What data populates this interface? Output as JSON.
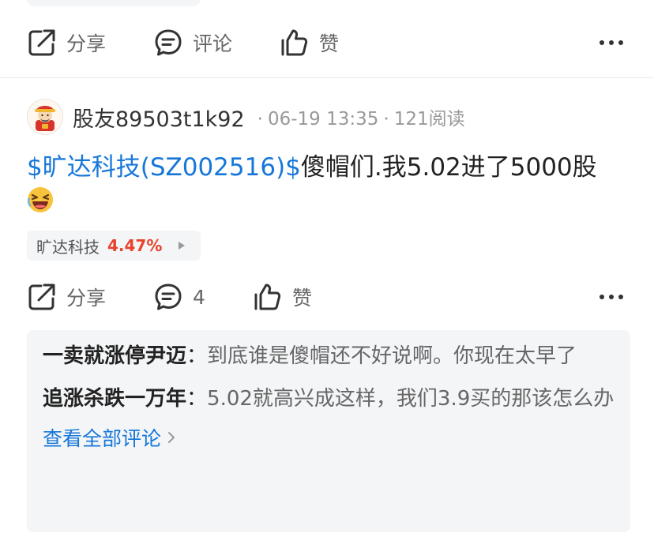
{
  "previous_post": {
    "actions": {
      "share_label": "分享",
      "comment_label": "评论",
      "like_label": "赞"
    }
  },
  "post": {
    "username": "股友89503t1k92",
    "date": "06-19 13:35",
    "reads": "121阅读",
    "meta_separator": "·",
    "stock_tag": "$旷达科技(SZ002516)$",
    "text": "傻帽们.我5.02进了5000股",
    "emoji": "laughing-face",
    "stock_chip": {
      "name": "旷达科技",
      "change": "4.47%",
      "change_color": "#e8432e"
    },
    "actions": {
      "share_label": "分享",
      "comment_count": "4",
      "like_label": "赞"
    }
  },
  "comments": [
    {
      "author": "一卖就涨停尹迈",
      "separator": "：",
      "text": "到底谁是傻帽还不好说啊。你现在太早了"
    },
    {
      "author": "追涨杀跌一万年",
      "separator": "：",
      "text": "5.02就高兴成这样，我们3.9买的那该怎么办"
    }
  ],
  "view_all_comments": "查看全部评论",
  "colors": {
    "link_blue": "#1677d9",
    "rise_red": "#e8432e",
    "muted_gray": "#999999",
    "panel_bg": "#f4f5f7"
  }
}
